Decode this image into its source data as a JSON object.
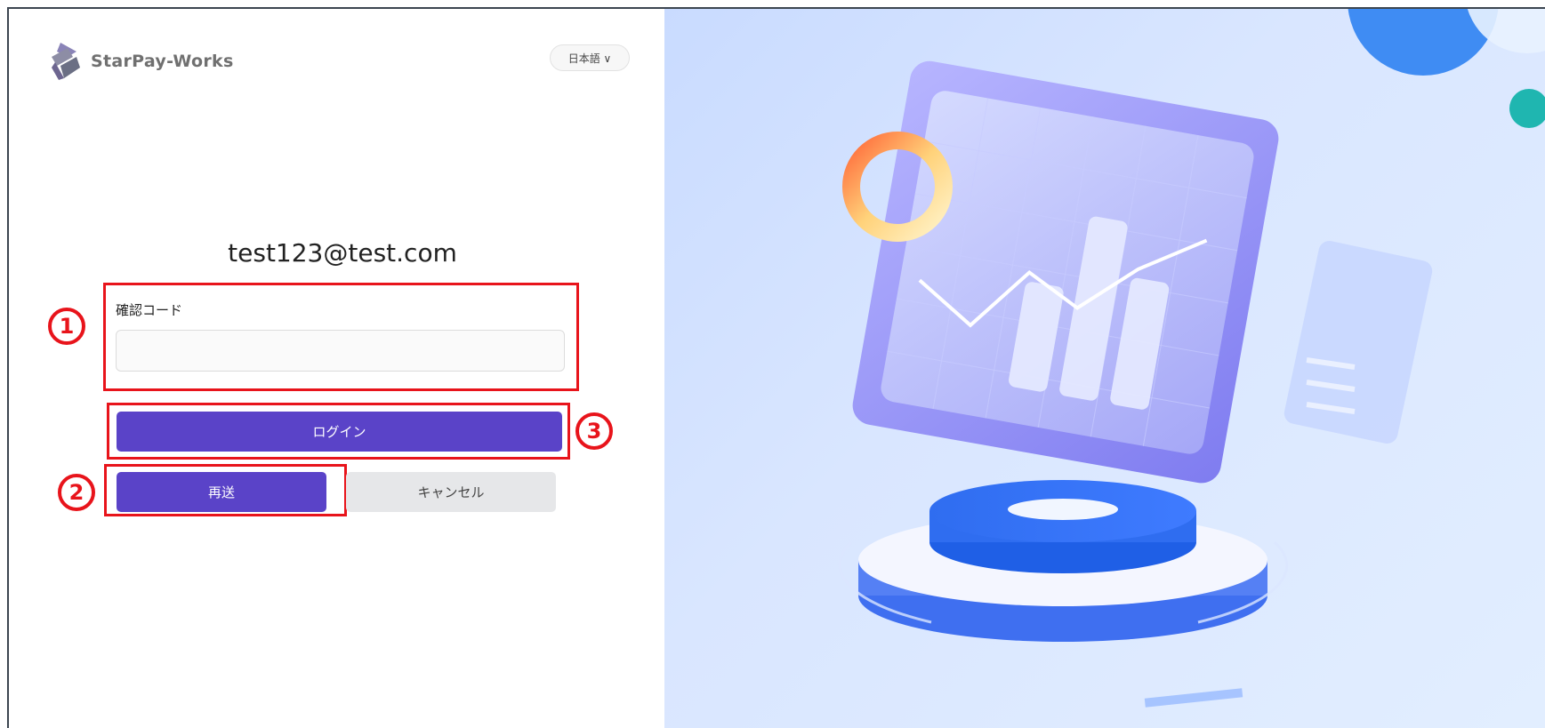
{
  "brand": {
    "name": "StarPay-Works",
    "colors": {
      "primary": "#5a43c8",
      "annotation_red": "#e8141b"
    }
  },
  "language_switch": {
    "label": "日本語 ∨"
  },
  "login": {
    "email": "test123@test.com",
    "code_label": "確認コード",
    "code_value": "",
    "login_label": "ログイン",
    "resend_label": "再送",
    "cancel_label": "キャンセル"
  },
  "annotations": [
    {
      "number": "1"
    },
    {
      "number": "2"
    },
    {
      "number": "3"
    }
  ]
}
